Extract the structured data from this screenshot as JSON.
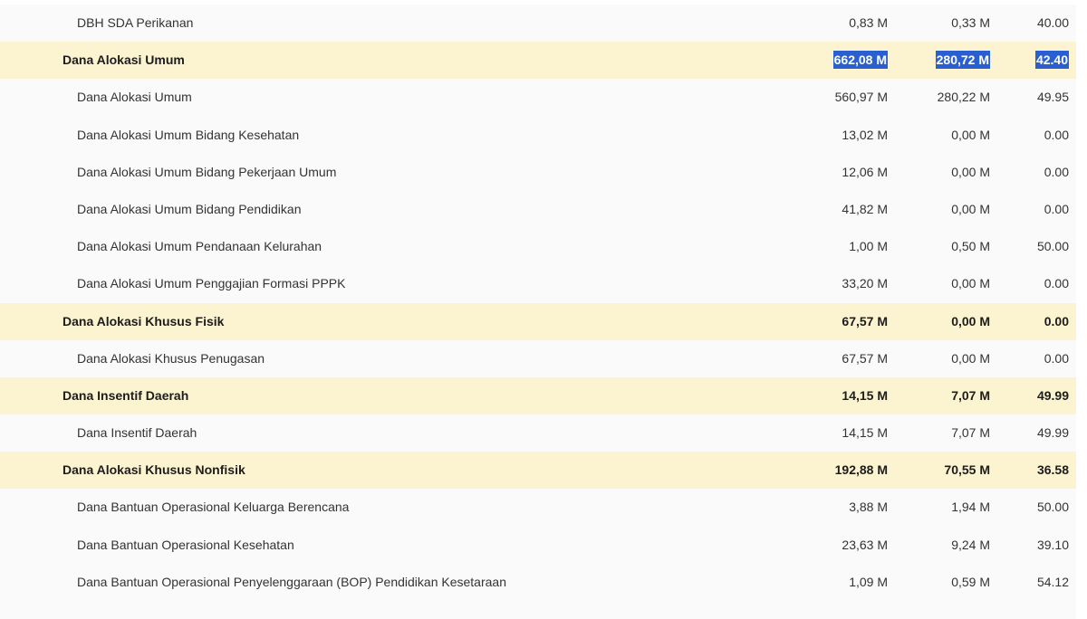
{
  "rows": [
    {
      "type": "item",
      "name": "DBH SDA Perikanan",
      "col1": "0,83 M",
      "col2": "0,33 M",
      "col3": "40.00"
    },
    {
      "type": "group",
      "name": "Dana Alokasi Umum",
      "col1": "662,08 M",
      "col2": "280,72 M",
      "col3": "42.40",
      "selected": true
    },
    {
      "type": "item",
      "name": "Dana Alokasi Umum",
      "col1": "560,97 M",
      "col2": "280,22 M",
      "col3": "49.95"
    },
    {
      "type": "item",
      "name": "Dana Alokasi Umum Bidang Kesehatan",
      "col1": "13,02 M",
      "col2": "0,00 M",
      "col3": "0.00"
    },
    {
      "type": "item",
      "name": "Dana Alokasi Umum Bidang Pekerjaan Umum",
      "col1": "12,06 M",
      "col2": "0,00 M",
      "col3": "0.00"
    },
    {
      "type": "item",
      "name": "Dana Alokasi Umum Bidang Pendidikan",
      "col1": "41,82 M",
      "col2": "0,00 M",
      "col3": "0.00"
    },
    {
      "type": "item",
      "name": "Dana Alokasi Umum Pendanaan Kelurahan",
      "col1": "1,00 M",
      "col2": "0,50 M",
      "col3": "50.00"
    },
    {
      "type": "item",
      "name": "Dana Alokasi Umum Penggajian Formasi PPPK",
      "col1": "33,20 M",
      "col2": "0,00 M",
      "col3": "0.00"
    },
    {
      "type": "group",
      "name": "Dana Alokasi Khusus Fisik",
      "col1": "67,57 M",
      "col2": "0,00 M",
      "col3": "0.00"
    },
    {
      "type": "item",
      "name": "Dana Alokasi Khusus Penugasan",
      "col1": "67,57 M",
      "col2": "0,00 M",
      "col3": "0.00"
    },
    {
      "type": "group",
      "name": "Dana Insentif Daerah",
      "col1": "14,15 M",
      "col2": "7,07 M",
      "col3": "49.99"
    },
    {
      "type": "item",
      "name": "Dana Insentif Daerah",
      "col1": "14,15 M",
      "col2": "7,07 M",
      "col3": "49.99"
    },
    {
      "type": "group",
      "name": "Dana Alokasi Khusus Nonfisik",
      "col1": "192,88 M",
      "col2": "70,55 M",
      "col3": "36.58"
    },
    {
      "type": "item",
      "name": "Dana Bantuan Operasional Keluarga Berencana",
      "col1": "3,88 M",
      "col2": "1,94 M",
      "col3": "50.00"
    },
    {
      "type": "item",
      "name": "Dana Bantuan Operasional Kesehatan",
      "col1": "23,63 M",
      "col2": "9,24 M",
      "col3": "39.10"
    },
    {
      "type": "item",
      "name": "Dana Bantuan Operasional Penyelenggaraan (BOP) Pendidikan Kesetaraan",
      "col1": "1,09 M",
      "col2": "0,59 M",
      "col3": "54.12"
    }
  ],
  "colors": {
    "group_row_bg": "#fcf3d0",
    "item_row_bg": "#fafafa",
    "selection_bg": "#2a5fd0"
  }
}
